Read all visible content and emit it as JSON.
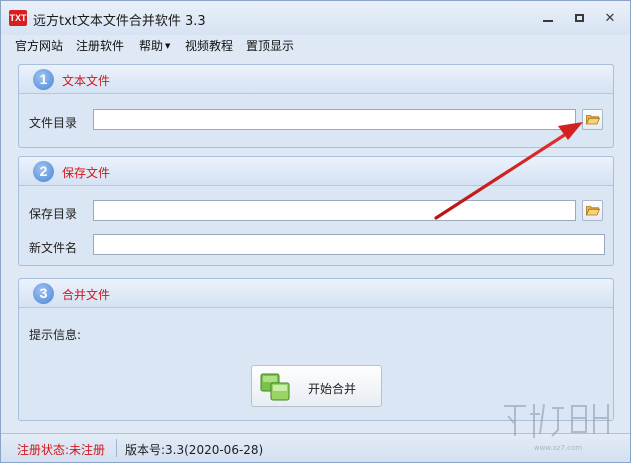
{
  "window": {
    "icon_text": "TXT",
    "title": "远方txt文本文件合并软件 3.3"
  },
  "menu": {
    "items": [
      {
        "label": "官方网站"
      },
      {
        "label": "注册软件"
      },
      {
        "label": "帮助",
        "has_dropdown": true
      },
      {
        "label": "视频教程"
      },
      {
        "label": "置顶显示"
      }
    ]
  },
  "panels": {
    "text_files": {
      "number": "1",
      "title": "文本文件",
      "dir_label": "文件目录",
      "dir_value": ""
    },
    "save_file": {
      "number": "2",
      "title": "保存文件",
      "dir_label": "保存目录",
      "dir_value": "",
      "name_label": "新文件名",
      "name_value": ""
    },
    "merge": {
      "number": "3",
      "title": "合并文件",
      "info_label": "提示信息:",
      "button_label": "开始合并"
    }
  },
  "status": {
    "registration": "注册状态:未注册",
    "version": "版本号:3.3(2020-06-28)"
  },
  "icons": {
    "folder": "folder-open-icon",
    "merge": "merge-icon",
    "minimize": "minimize-icon",
    "maximize": "maximize-icon",
    "close": "close-icon"
  },
  "colors": {
    "accent_red": "#d0161a",
    "arrow_red": "#d42020",
    "panel_bg": "#dbe6f4",
    "number_blue": "#4b86d8"
  }
}
